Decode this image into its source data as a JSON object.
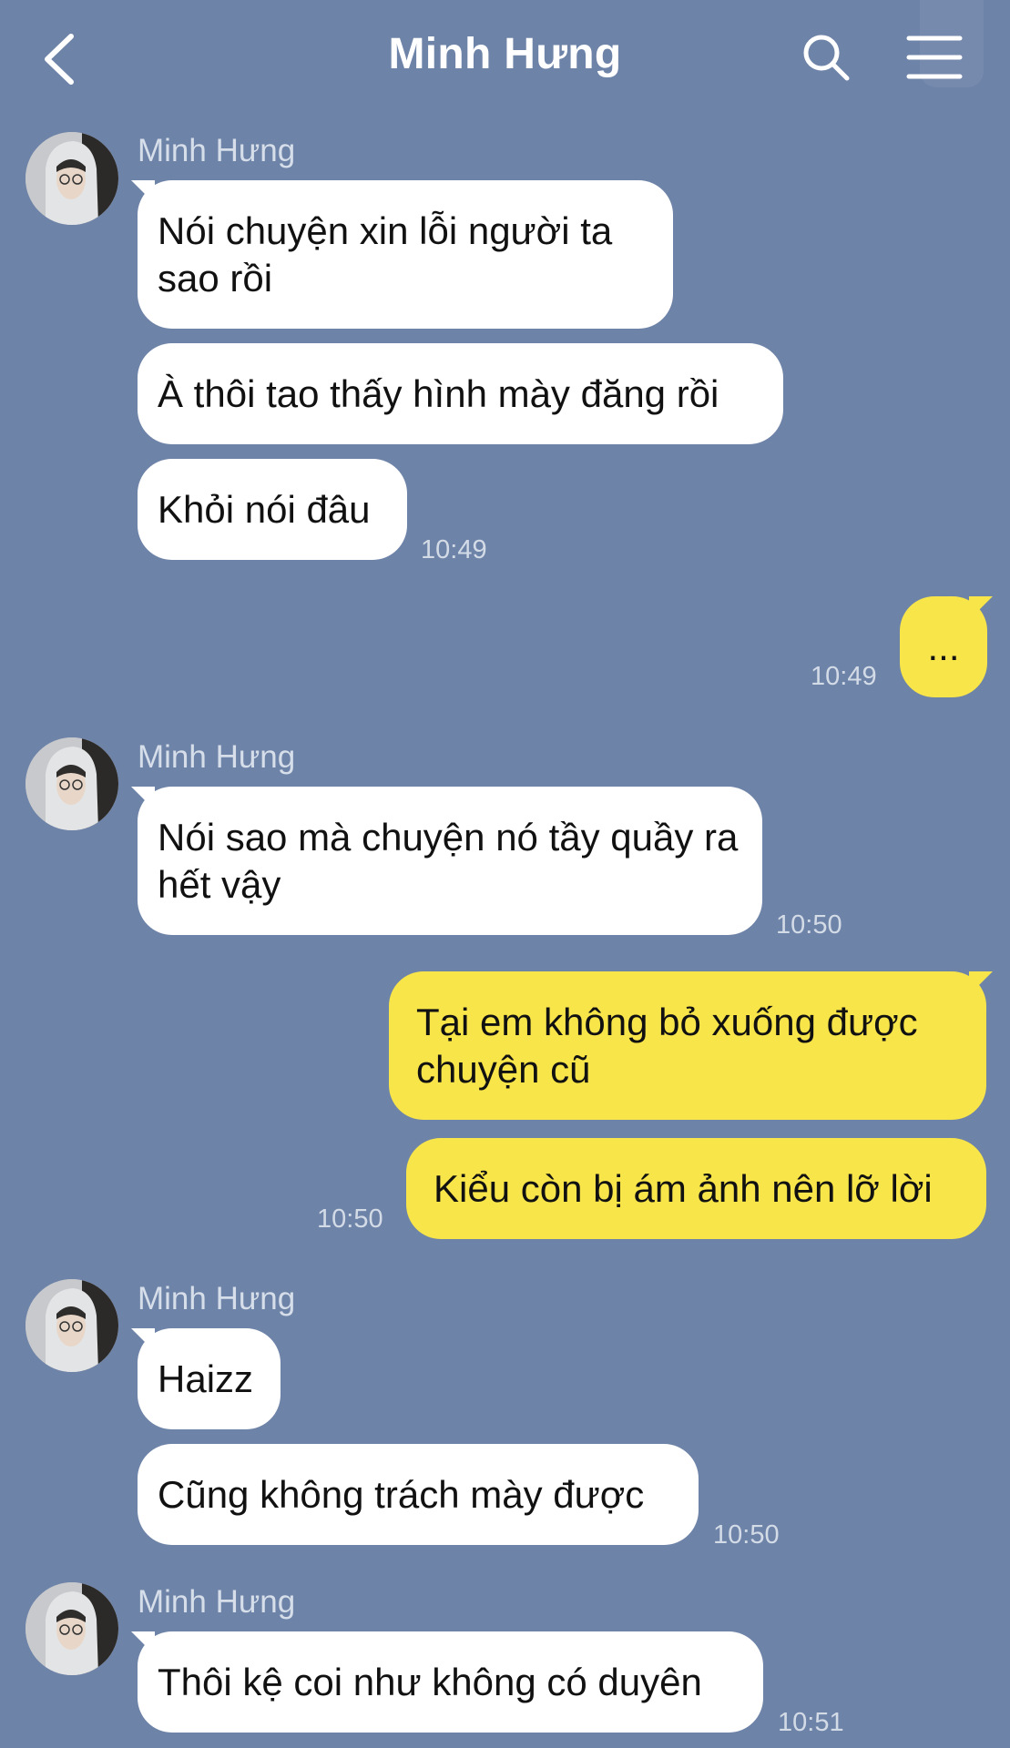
{
  "header": {
    "title": "Minh Hưng"
  },
  "messages": {
    "g1": {
      "sender": "Minh Hưng",
      "m1": "Nói chuyện xin lỗi người ta sao rồi",
      "m2": "À thôi tao thấy hình mày đăng rồi",
      "m3": "Khỏi nói đâu",
      "time": "10:49"
    },
    "o1": {
      "m1": "...",
      "time": "10:49"
    },
    "g2": {
      "sender": "Minh Hưng",
      "m1": "Nói sao mà chuyện nó tầy quầy ra hết vậy",
      "time": "10:50"
    },
    "o2": {
      "m1": "Tại em không bỏ xuống được chuyện cũ",
      "m2": "Kiểu còn bị ám ảnh nên lỡ lời",
      "time": "10:50"
    },
    "g3": {
      "sender": "Minh Hưng",
      "m1": "Haizz",
      "m2": "Cũng không trách mày được",
      "time": "10:50"
    },
    "g4": {
      "sender": "Minh Hưng",
      "m1": "Thôi kệ coi như không có duyên",
      "time": "10:51"
    }
  },
  "icons": {
    "back": "chevron-left-icon",
    "search": "search-icon",
    "menu": "hamburger-menu-icon"
  },
  "colors": {
    "background": "#6e83a8",
    "incoming_bubble": "#ffffff",
    "outgoing_bubble": "#f8e54a"
  }
}
